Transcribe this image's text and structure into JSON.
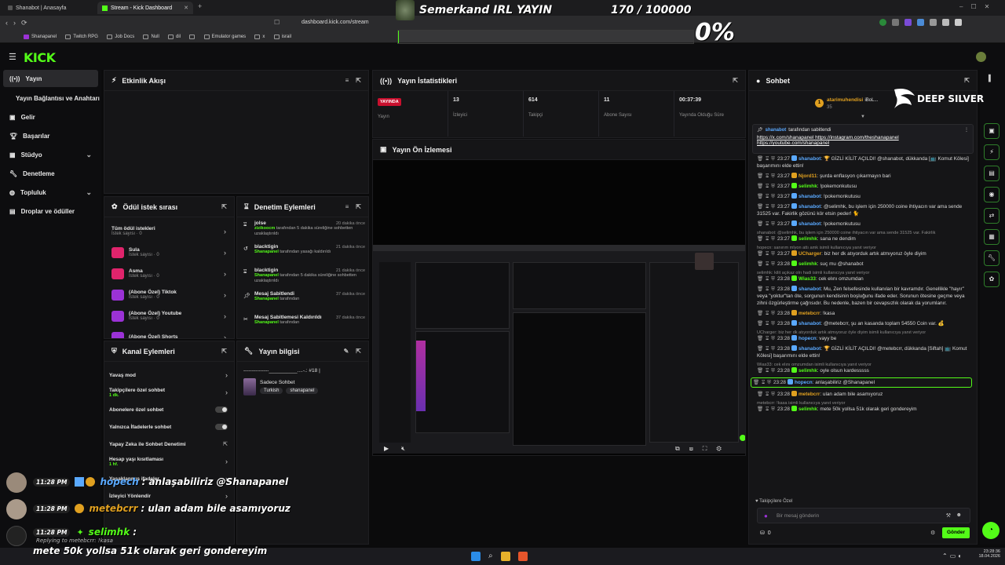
{
  "browser": {
    "tabs": [
      {
        "label": "Shanabot | Anasayfa"
      },
      {
        "label": "Stream - Kick Dashboard"
      }
    ],
    "url": "dashboard.kick.com/stream",
    "bookmarks": [
      "Shanapanel",
      "Twitch RPG",
      "Job Docs",
      "Null",
      "dil",
      "Emulator games",
      "x",
      "israil"
    ]
  },
  "overlay": {
    "title": "Semerkand IRL YAYIN",
    "goal": "170 / 100000",
    "percent": "0%",
    "brand": "DEEP SILVER",
    "chat": [
      {
        "time": "11:28 PM",
        "user": "hopech",
        "sep": ":",
        "text": "anlaşabiliriz @Shanapanel"
      },
      {
        "time": "11:28 PM",
        "user": "metebcrr",
        "sep": ":",
        "text": "ulan adam bile asamıyoruz"
      },
      {
        "time": "11:28 PM",
        "user": "selimhk",
        "sep": ":",
        "reply": "Replying to metebcrr: !kasa",
        "text": "mete 50k yollsa 51k olarak geri gondereyim"
      }
    ]
  },
  "sidebar": {
    "items": [
      {
        "label": "Yayın",
        "icon": "broadcast-icon"
      },
      {
        "label": "Yayın Bağlantısı ve Anahtarı"
      },
      {
        "label": "Gelir",
        "icon": "money-icon"
      },
      {
        "label": "Başarılar",
        "icon": "trophy-icon"
      },
      {
        "label": "Stüdyo",
        "icon": "studio-icon"
      },
      {
        "label": "Denetleme",
        "icon": "wrench-icon"
      },
      {
        "label": "Topluluk",
        "icon": "community-icon"
      },
      {
        "label": "Droplar ve ödüller",
        "icon": "drops-icon"
      }
    ]
  },
  "panels": {
    "activity": {
      "title": "Etkinlik Akışı"
    },
    "stats": {
      "title": "Yayın İstatistikleri",
      "live_badge": "YAYINDA",
      "cells": [
        {
          "value": "",
          "label": "Yayın"
        },
        {
          "value": "13",
          "label": "İzleyici"
        },
        {
          "value": "614",
          "label": "Takipçi"
        },
        {
          "value": "11",
          "label": "Abone Sayısı"
        },
        {
          "value": "00:37:39",
          "label": "Yayında Olduğu Süre"
        }
      ]
    },
    "preview": {
      "title": "Yayın Ön İzlemesi"
    },
    "rewards": {
      "title": "Ödül istek sırası",
      "items": [
        {
          "name": "Tüm ödül istekleri",
          "sub": "İstek sayısı · 0",
          "color": ""
        },
        {
          "name": "Sula",
          "sub": "İstek sayısı · 0",
          "color": "#e0246c"
        },
        {
          "name": "Asma",
          "sub": "İstek sayısı · 0",
          "color": "#e0246c"
        },
        {
          "name": "(Abone Özel) Tiktok",
          "sub": "İstek sayısı · 0",
          "color": "#9b32d6"
        },
        {
          "name": "(Abone Özel) Youtube",
          "sub": "İstek sayısı · 0",
          "color": "#9b32d6"
        },
        {
          "name": "(Abone Özel) Shorts",
          "sub": "",
          "color": "#9b32d6"
        }
      ]
    },
    "modlog": {
      "title": "Denetim Eylemleri",
      "items": [
        {
          "user": "jolse",
          "time": "20 dakika önce",
          "actor": "zizikoocm",
          "desc": " tarafından 5 dakika süreliğine sohbetten uzaklaştırıldı"
        },
        {
          "user": "blacktigin",
          "time": "21 dakika önce",
          "actor": "Shanapanel",
          "desc": " tarafından yasağı kaldırıldı"
        },
        {
          "user": "blacktigin",
          "time": "21 dakika önce",
          "actor": "Shanapanel",
          "desc": " tarafından 5 dakika süreliğine sohbetten uzaklaştırıldı"
        },
        {
          "user": "Mesaj Sabitlendi",
          "time": "37 dakika önce",
          "actor": "Shanapanel",
          "desc": " tarafından"
        },
        {
          "user": "Mesaj Sabitlemesi Kaldırıldı",
          "time": "37 dakika önce",
          "actor": "Shanapanel",
          "desc": " tarafından"
        }
      ]
    },
    "channel": {
      "title": "Kanal Eylemleri",
      "items": [
        {
          "label": "Yavaş mod",
          "sub": "",
          "kind": "arrow"
        },
        {
          "label": "Takipçilere özel sohbet",
          "sub": "1 dk.",
          "kind": "arrow"
        },
        {
          "label": "Abonelere özel sohbet",
          "sub": "",
          "kind": "toggle"
        },
        {
          "label": "Yalnızca İfadelerle sohbet",
          "sub": "",
          "kind": "toggle"
        },
        {
          "label": "Yapay Zeka ile Sohbet Denetimi",
          "sub": "",
          "kind": "ext"
        },
        {
          "label": "Hesap yaşı kısıtlaması",
          "sub": "1 hf.",
          "kind": "arrow"
        },
        {
          "label": "Yasaklanmış ifadeler",
          "sub": "",
          "kind": "arrow"
        },
        {
          "label": "İzleyici Yönlendir",
          "sub": "",
          "kind": "arrow"
        }
      ]
    },
    "info": {
      "title": "Yayın bilgisi",
      "stream_title": "---------------__________....-.: #18 |",
      "category": "Sadece Sohbet",
      "tags": [
        "Turkish",
        "shanapanel"
      ]
    }
  },
  "chat": {
    "title": "Sohbet",
    "top_user": {
      "name": "atarimuhendisi",
      "count": "35",
      "name2": "iBoL..."
    },
    "pinned": {
      "by": "shanabot",
      "by_suffix": " tarafından sabitlendi",
      "lines": [
        "https://x.com/shanapanel https://instagram.com/theshanapanel",
        "https://youtube.com/shanapanel"
      ]
    },
    "messages": [
      {
        "time": "23:27",
        "user": "shanabot",
        "color": "#5aa9ff",
        "text": "🏆 GİZLİ KİLİT AÇILDI! @shanabot, dükkanda [📺 Komut Kölesi] başarımını elde ettin!",
        "reply": ""
      },
      {
        "time": "23:27",
        "user": "Njord11",
        "color": "#e0a020",
        "text": "şurda enflasyon çıkarmayın bari",
        "reply": ""
      },
      {
        "time": "23:27",
        "user": "selimhk",
        "color": "#53fc18",
        "text": "!pokemonkutusu",
        "reply": ""
      },
      {
        "time": "23:27",
        "user": "shanabot",
        "color": "#5aa9ff",
        "text": "!pokemonkutusu",
        "reply": ""
      },
      {
        "time": "23:27",
        "user": "shanabot",
        "color": "#5aa9ff",
        "text": "@selimhk, bu işlem için 250000 coine ihtiyacın var ama sende 31525 var. Fakirlik gözünü kör etsin peder! 🐈",
        "reply": ""
      },
      {
        "time": "23:27",
        "user": "shanabot",
        "color": "#5aa9ff",
        "text": "!pokemonkutusu",
        "reply": ""
      },
      {
        "time": "23:27",
        "user": "selimhk",
        "color": "#53fc18",
        "text": "sana ne dendim",
        "reply": "shanabot: @selimhk, bu işlem için 250000 coine ihtiyacın var ama sende 31525 var. Fakirlik"
      },
      {
        "time": "23:27",
        "user": "UCharger",
        "color": "#e0a020",
        "text": "biz her dk atıyorduk artık atmıyoruz öyle diyim",
        "reply": "hopecn: sanırım mlyon attı amk isimli kullanıcıya yanıt veriyor"
      },
      {
        "time": "23:28",
        "user": "selimhk",
        "color": "#53fc18",
        "text": "suç mu @shanabot",
        "reply": ""
      },
      {
        "time": "23:28",
        "user": "Wias33",
        "color": "#53fc18",
        "text": "cek elını omzumdan",
        "reply": "selimhk: kilit açıkaz olrı hadi isimli kullanıcıya yanıt veriyor"
      },
      {
        "time": "23:28",
        "user": "shanabot",
        "color": "#5aa9ff",
        "text": "Mu, Zen felsefesinde kullanılan bir kavramdır. Genellikle \"hayır\" veya \"yoktur\"tan öte, sorgunun kendisinin boşluğunu ifade eder. Sorunun ötesine geçme veya zihni özgürleştirme çağrısıdır. Bu nedenle, bazen bir cevapsızlık olarak da yorumlanır.",
        "reply": ""
      },
      {
        "time": "23:28",
        "user": "metebcrr",
        "color": "#e0a020",
        "text": "!kasa",
        "reply": ""
      },
      {
        "time": "23:28",
        "user": "shanabot",
        "color": "#5aa9ff",
        "text": "@metebcrr, şu an kasanda toplam 54550 Coin var. 💰",
        "reply": ""
      },
      {
        "time": "23:28",
        "user": "hopecn",
        "color": "#5aa9ff",
        "text": "vayy be",
        "reply": "UCharger: biz her dk atıyorduk artık atmıyoruz öyle diyim isimli kullanıcıya yanıt veriyor"
      },
      {
        "time": "23:28",
        "user": "shanabot",
        "color": "#5aa9ff",
        "text": "🏆 GİZLİ KİLİT AÇILDI! @metebcrr, dükkanda [Siftah] 📺 Komut Kölesi] başarımını elde ettin!",
        "reply": ""
      },
      {
        "time": "23:28",
        "user": "selimhk",
        "color": "#53fc18",
        "text": "oyle olsun kardesssss",
        "reply": "Wias33: cek elını omzumdan isimli kullanıcıya yanıt veriyor"
      },
      {
        "time": "23:28",
        "user": "hopecn",
        "color": "#5aa9ff",
        "text": "anlaşabiliriz @Shanapanel",
        "reply": ""
      },
      {
        "time": "23:28",
        "user": "metebcrr",
        "color": "#e0a020",
        "text": "ulan adam bile asamıyoruz",
        "reply": ""
      },
      {
        "time": "23:28",
        "user": "selimhk",
        "color": "#53fc18",
        "text": "mete 50k yollsa 51k olarak geri gondereyim",
        "reply": "metebcrr: !kasa isimli kullanıcıya yanıt veriyor"
      }
    ],
    "mode_note": "Takipçilere Özel",
    "input_placeholder": "Bir mesaj gönderin",
    "points": "0",
    "send_label": "Gönder"
  },
  "taskbar": {
    "time": "23:28:36",
    "date": "18.04.2026"
  }
}
